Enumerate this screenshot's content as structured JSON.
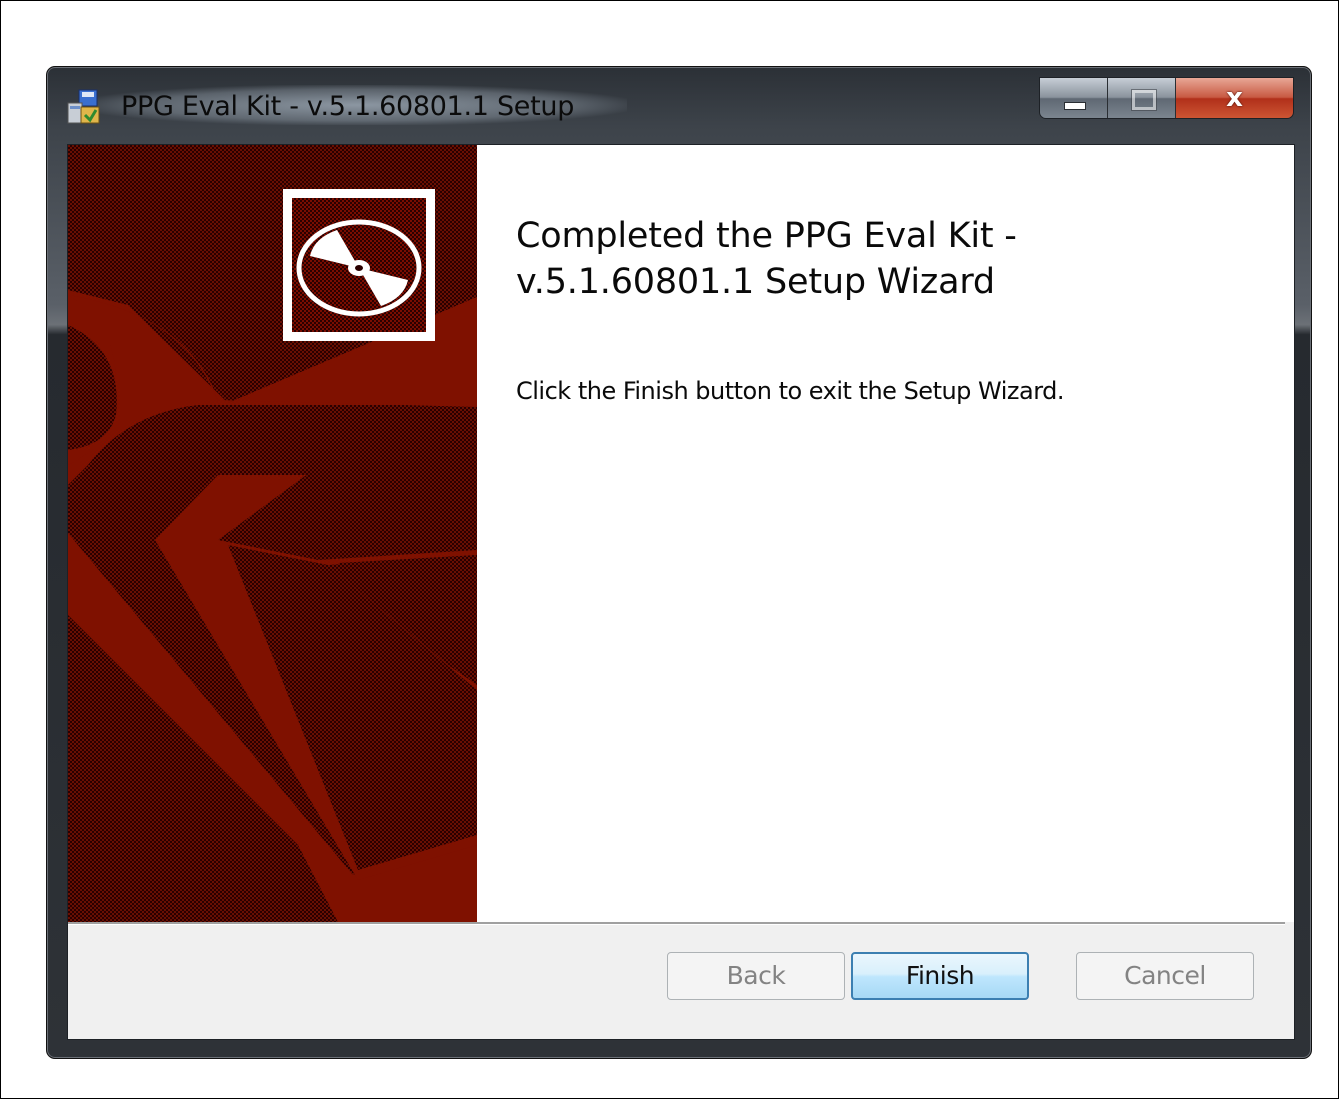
{
  "window": {
    "title": "PPG Eval Kit - v.5.1.60801.1 Setup"
  },
  "icons": {
    "app": "installer-icon",
    "banner": "cd-disc-icon",
    "minimize": "minimize-icon",
    "maximize": "maximize-icon",
    "close": "close-icon"
  },
  "titlebar_buttons": {
    "close_glyph": "x"
  },
  "wizard": {
    "heading_line1": "Completed the PPG Eval Kit -",
    "heading_line2": "v.5.1.60801.1 Setup Wizard",
    "description": "Click the Finish button to exit the Setup Wizard."
  },
  "buttons": {
    "back": {
      "label": "Back",
      "enabled": false
    },
    "finish": {
      "label": "Finish",
      "enabled": true,
      "default": true
    },
    "cancel": {
      "label": "Cancel",
      "enabled": false
    }
  },
  "colors": {
    "banner_red": "#7f1100",
    "banner_dark": "#2a0000",
    "finish_border": "#3c7fb1",
    "close_red": "#c3412a"
  }
}
